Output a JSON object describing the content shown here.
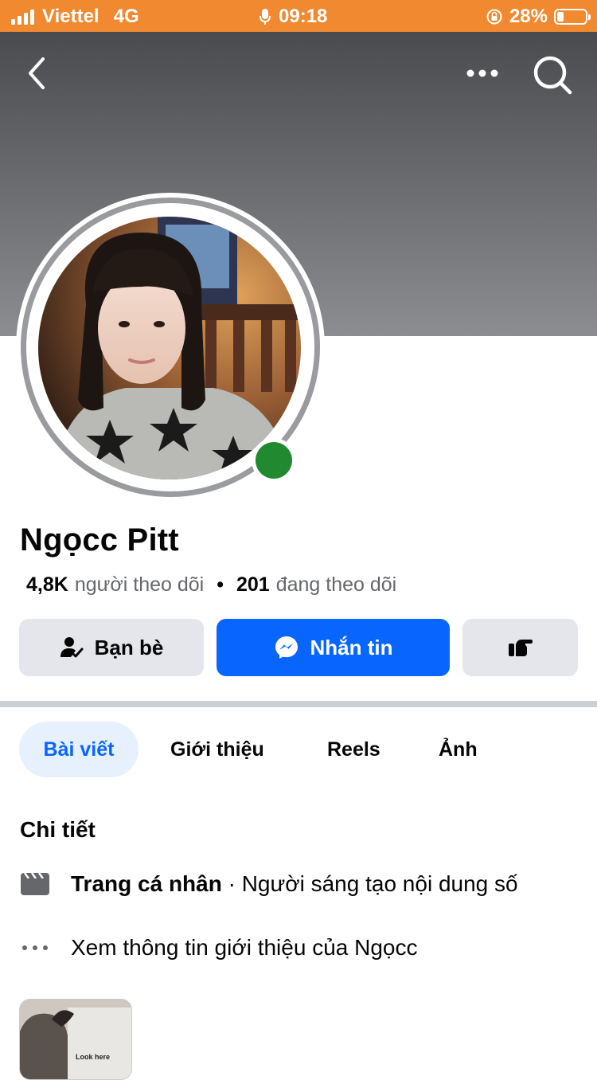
{
  "status_bar": {
    "carrier": "Viettel",
    "network": "4G",
    "time": "09:18",
    "battery": "28%",
    "battery_level": 0.28
  },
  "header": {
    "back_icon": "chevron-left-icon",
    "more_icon": "more-horizontal-icon",
    "search_icon": "search-icon"
  },
  "profile": {
    "name": "Ngọcc Pitt",
    "followers_count": "4,8K",
    "followers_label": "người theo dõi",
    "separator": "•",
    "following_count": "201",
    "following_label": "đang theo dõi",
    "online": true
  },
  "actions": {
    "friends_label": "Bạn bè",
    "message_label": "Nhắn tin",
    "accent": "#0866ff"
  },
  "tabs": [
    {
      "label": "Bài viết",
      "active": true
    },
    {
      "label": "Giới thiệu",
      "active": false
    },
    {
      "label": "Reels",
      "active": false
    },
    {
      "label": "Ảnh",
      "active": false
    }
  ],
  "details": {
    "title": "Chi tiết",
    "profile_type_bold": "Trang cá nhân",
    "profile_type_rest": " · Người sáng tạo nội dung số",
    "see_about": "Xem thông tin giới thiệu của Ngọcc"
  },
  "thumbnail": {
    "caption": "Look here"
  }
}
